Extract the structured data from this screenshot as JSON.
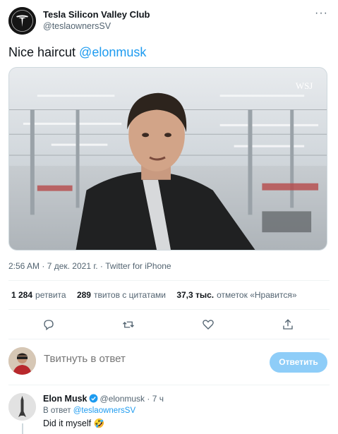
{
  "author": {
    "name": "Tesla Silicon Valley Club",
    "handle": "@teslaownersSV"
  },
  "tweet": {
    "text_prefix": "Nice haircut ",
    "mention": "@elonmusk",
    "meta": "2:56 AM · 7 дек. 2021 г. · Twitter for iPhone",
    "media_watermark": "WSJ"
  },
  "stats": {
    "retweets_count": "1 284",
    "retweets_label": "ретвита",
    "quotes_count": "289",
    "quotes_label": "твитов с цитатами",
    "likes_count": "37,3 тыс.",
    "likes_label": "отметок «Нравится»"
  },
  "actions": [
    "reply-icon",
    "retweet-icon",
    "like-icon",
    "share-icon"
  ],
  "reply_box": {
    "placeholder": "Твитнуть в ответ",
    "button_label": "Ответить"
  },
  "reply_tweet": {
    "name": "Elon Musk",
    "handle": "@elonmusk",
    "time": "· 7 ч",
    "reply_to_prefix": "В ответ ",
    "reply_to_handle": "@teslaownersSV",
    "text": "Did it myself 🤣"
  },
  "colors": {
    "accent": "#1d9bf0",
    "reply_button": "#8ecdf8",
    "secondary_text": "#536471"
  }
}
